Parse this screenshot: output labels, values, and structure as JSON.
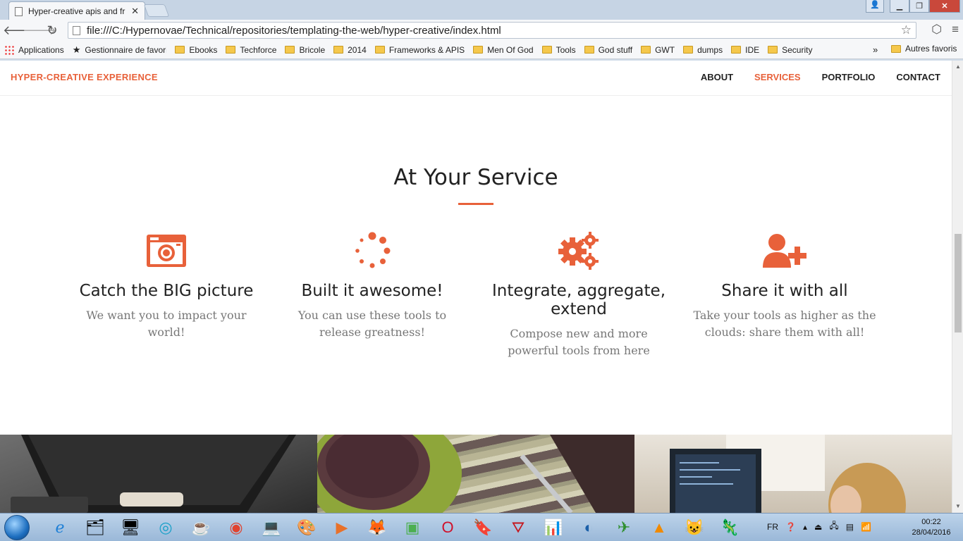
{
  "browser": {
    "tab_title": "Hyper-creative apis and fr",
    "url": "file:///C:/Hypernovae/Technical/repositories/templating-the-web/hyper-creative/index.html",
    "bookmarks": [
      "Applications",
      "Gestionnaire de favori",
      "Ebooks",
      "Techforce",
      "Bricole",
      "2014",
      "Frameworks & APIS",
      "Men Of God",
      "Tools",
      "God stuff",
      "GWT",
      "dumps",
      "IDE",
      "Security"
    ],
    "bookmarks_more": "»",
    "other_bookmarks": "Autres favoris"
  },
  "site": {
    "brand": "HYPER-CREATIVE EXPERIENCE",
    "nav": [
      {
        "label": "ABOUT",
        "active": false
      },
      {
        "label": "SERVICES",
        "active": true
      },
      {
        "label": "PORTFOLIO",
        "active": false
      },
      {
        "label": "CONTACT",
        "active": false
      }
    ],
    "section_title": "At Your Service",
    "accent_color": "#e8613a",
    "services": [
      {
        "icon": "camera-icon",
        "title": "Catch the BIG picture",
        "text": "We want you to impact your world!"
      },
      {
        "icon": "spinner-icon",
        "title": "Built it awesome!",
        "text": "You can use these tools to release greatness!"
      },
      {
        "icon": "gears-icon",
        "title": "Integrate, aggregate, extend",
        "text": "Compose new and more powerful tools from here"
      },
      {
        "icon": "user-plus-icon",
        "title": "Share it with all",
        "text": "Take your tools as higher as the clouds: share them with all!"
      }
    ]
  },
  "taskbar": {
    "language": "FR",
    "time": "00:22",
    "date": "28/04/2016"
  }
}
